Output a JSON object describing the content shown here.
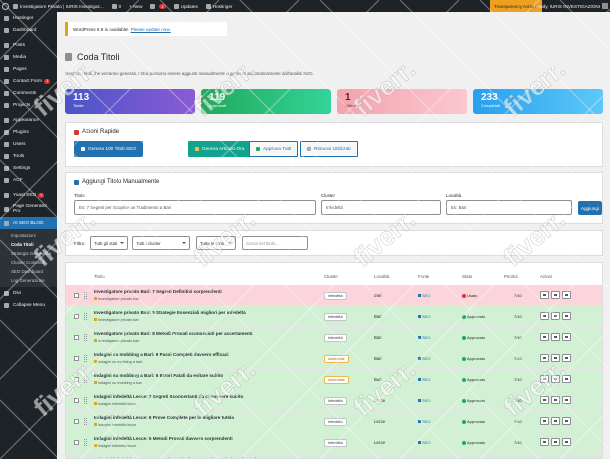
{
  "adminbar": {
    "site": "Investigatore Privato | IURIS Investigaz...",
    "comments_count": "0",
    "new_label": "+ New",
    "yoast_count": "1",
    "updates_label": "Updates",
    "hostinger_label": "Hostinger",
    "transparency_label": "Transparency Actions",
    "howdy": "Howdy, IURIS INVESTIGAZIONI"
  },
  "sidebar": {
    "items": [
      {
        "label": "Hostinger",
        "bubble": ""
      },
      {
        "label": "Dashboard",
        "bubble": ""
      },
      {
        "label": "Posts",
        "bubble": ""
      },
      {
        "label": "Media",
        "bubble": ""
      },
      {
        "label": "Pages",
        "bubble": ""
      },
      {
        "label": "Contact Form",
        "bubble": "1"
      },
      {
        "label": "Comments",
        "bubble": ""
      },
      {
        "label": "Projects",
        "bubble": ""
      },
      {
        "label": "Appearance",
        "bubble": ""
      },
      {
        "label": "Plugins",
        "bubble": ""
      },
      {
        "label": "Users",
        "bubble": ""
      },
      {
        "label": "Tools",
        "bubble": ""
      },
      {
        "label": "Settings",
        "bubble": ""
      },
      {
        "label": "ACF",
        "bubble": ""
      },
      {
        "label": "Yoast SEO",
        "bubble": "1"
      },
      {
        "label": "Page Generator Pro",
        "bubble": ""
      },
      {
        "label": "AI SEO BLOG",
        "bubble": ""
      }
    ],
    "submenu": [
      "Impostazioni",
      "Coda Titoli",
      "Strategia Geografica",
      "Cluster Contenuti",
      "SEO Dashboard",
      "Log Generazione"
    ],
    "after": [
      {
        "label": "Divi"
      },
      {
        "label": "Collapse Menu"
      }
    ]
  },
  "notice": {
    "text": "WordPress 6.9 is available!",
    "link": "Please update now."
  },
  "page": {
    "title": "Coda Titoli",
    "description": "Gestisci i titoli che verranno generati. I titoli possono essere aggiunti manualmente o generati automaticamente dall'analisi SEO."
  },
  "stats": [
    {
      "value": "113",
      "label": "Totale"
    },
    {
      "value": "119",
      "label": "Approvati"
    },
    {
      "value": "1",
      "label": "Utilizzati"
    },
    {
      "value": "233",
      "label": "Completati"
    }
  ],
  "quick_actions": {
    "title": "Azioni Rapide",
    "buttons": [
      "Genera 100 Titoli SEO",
      "Genera Articolo Ora",
      "Approva Tutti",
      "Rimuovi Utilizzati"
    ]
  },
  "add_title": {
    "title": "Aggiungi Titolo Manualmente",
    "title_label": "Titolo",
    "title_placeholder": "Es: 7 Segreti per Scoprire un Tradimento a Bari",
    "cluster_label": "Cluster",
    "cluster_value": "Infedeltà",
    "location_label": "Località",
    "location_placeholder": "Es: Bari",
    "button": "Aggiungi"
  },
  "filters": {
    "label": "Filtra:",
    "status": "Tutti gli stati",
    "cluster": "Tutti i cluster",
    "source": "Tutte le fonti",
    "search_placeholder": "Cerca nel titolo..."
  },
  "table": {
    "headers": [
      "Titolo",
      "Cluster",
      "Località",
      "Fonte",
      "Stato",
      "Priorità",
      "Azioni"
    ],
    "rows": [
      {
        "title": "Investigatore privato Bari: 7 Segreti Definitivi sorprendenti",
        "keyword": "investigatore privato bari",
        "cluster": "Infedeltà",
        "location": "Bari",
        "source": "SEO",
        "status": "Usato",
        "priority": "7/10",
        "tone": "pink"
      },
      {
        "title": "Investigatore privato Bari: 5 Strategie Essenziali migliori per infedeltà",
        "keyword": "investigatore privato bari",
        "cluster": "Infedeltà",
        "location": "Bari",
        "source": "SEO",
        "status": "Approvato",
        "priority": "7/10",
        "tone": "green"
      },
      {
        "title": "Investigatore privato Bari: 8 Metodi Provati sconosciuti per accertamenti",
        "keyword": "investigatore privato bari",
        "cluster": "Infedeltà",
        "location": "Bari",
        "source": "SEO",
        "status": "Approvato",
        "priority": "7/10",
        "tone": "green"
      },
      {
        "title": "Indagini su mobbing a Bari: 9 Passi Completi davvero efficaci",
        "keyword": "indagini su mobbing a bari",
        "cluster": "Aziendale",
        "location": "Bari",
        "source": "SEO",
        "status": "Approvato",
        "priority": "7/10",
        "tone": "green"
      },
      {
        "title": "Indagini su mobbing a Bari: 5 Errori Fatali da evitare subito",
        "keyword": "indagini su mobbing a bari",
        "cluster": "Aziendale",
        "location": "Bari",
        "source": "SEO",
        "status": "Approvato",
        "priority": "7/10",
        "tone": "green"
      },
      {
        "title": "Indagini infedeltà Lecce: 7 Segreti Sconcertanti da conoscere subito",
        "keyword": "indagini infedeltà lecce",
        "cluster": "Infedeltà",
        "location": "Lecce",
        "source": "SEO",
        "status": "Approvato",
        "priority": "7/10",
        "tone": "green"
      },
      {
        "title": "Indagini infedeltà Lecce: 6 Prove Complete per la migliore tutela",
        "keyword": "indagini infedeltà lecce",
        "cluster": "Infedeltà",
        "location": "Lecce",
        "source": "SEO",
        "status": "Approvato",
        "priority": "7/10",
        "tone": "green"
      },
      {
        "title": "Indagini infedeltà Lecce: 5 Metodi Provati davvero sorprendenti",
        "keyword": "indagini infedeltà lecce",
        "cluster": "Infedeltà",
        "location": "Lecce",
        "source": "SEO",
        "status": "Approvato",
        "priority": "7/10",
        "tone": "green"
      },
      {
        "title": "Indagini infedeltà Lecce: 8 Strategie Esclusive contro i peggiori tradimenti",
        "keyword": "indagini infedeltà lecce",
        "cluster": "Infedeltà",
        "location": "Lecce",
        "source": "SEO",
        "status": "Approvato",
        "priority": "7/10",
        "tone": "green"
      }
    ]
  },
  "watermark": "fiverr.",
  "colors": {
    "accent": "#2271b1",
    "sidebar": "#1d2327",
    "row_used": "#fbd5d9",
    "row_approved": "#d2f0d4"
  }
}
